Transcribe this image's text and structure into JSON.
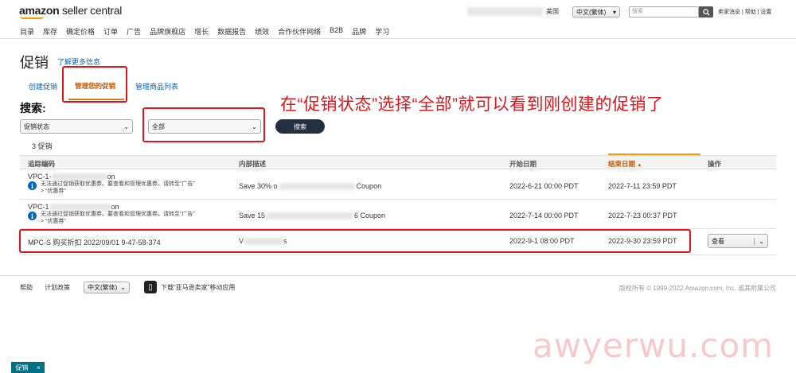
{
  "header": {
    "logo_brand": "amazon",
    "logo_suffix": " seller central",
    "marketplace": "美国",
    "language": "中文(繁体)",
    "search_placeholder": "搜索",
    "top_links": "卖家消息 | 帮助 | 设置",
    "accent_color": "#ff9900"
  },
  "nav": [
    "目录",
    "库存",
    "确定价格",
    "订单",
    "广告",
    "品牌旗舰店",
    "增长",
    "数据报告",
    "绩效",
    "合作伙伴网络",
    "B2B",
    "品牌",
    "学习"
  ],
  "page": {
    "title": "促销",
    "learn_more": "了解更多信息",
    "tabs": [
      "创建促销",
      "管理您的促销",
      "管理商品列表"
    ]
  },
  "search": {
    "label": "搜索:",
    "field_select": "促销状态",
    "status_select": "全部",
    "button": "搜索",
    "result_count": "3 促销"
  },
  "annotation": "在“促销状态”选择“全部”就可以看到刚创建的促销了",
  "table": {
    "headers": [
      "追踪编码",
      "内部描述",
      "开始日期",
      "结束日期",
      "操作"
    ],
    "sort_indicator": "▲",
    "rows": [
      {
        "code_a": "VPC-1-",
        "code_b": "on",
        "note_line1": "无法通过促销获取优惠券。要查看和管理优惠券，请转至“广告”",
        "note_line2": "> “优惠券”",
        "desc_a": "Save 30% o",
        "desc_b": "Coupon",
        "start": "2022-6-21 00:00 PDT",
        "end": "2022-7-11 23:59 PDT"
      },
      {
        "code_a": "VPC-1",
        "code_b": "on",
        "note_line1": "无法通过促销获取优惠券。要查看和管理优惠券，请转至“广告”",
        "note_line2": "> “优惠券”",
        "desc_a": "Save 15",
        "desc_b": "6 Coupon",
        "start": "2022-7-14 00:00 PDT",
        "end": "2022-7-23 00:37 PDT"
      },
      {
        "code": "MPC-S 购买折扣 2022/09/01 9-47-58-374",
        "desc_a": "V",
        "desc_b": "s",
        "start": "2022-9-1 08:00 PDT",
        "end": "2022-9-30 23:59 PDT",
        "action": "查看"
      }
    ]
  },
  "footer": {
    "help": "帮助",
    "policy": "计划政策",
    "language": "中文(繁体)",
    "app_download": "下载“亚马逊卖家”移动应用",
    "copyright": "版权所有 © 1999-2022 Amazon.com, Inc. 或其附属公司"
  },
  "watermark": "awyerwu.com",
  "bottom_tag": "促销"
}
